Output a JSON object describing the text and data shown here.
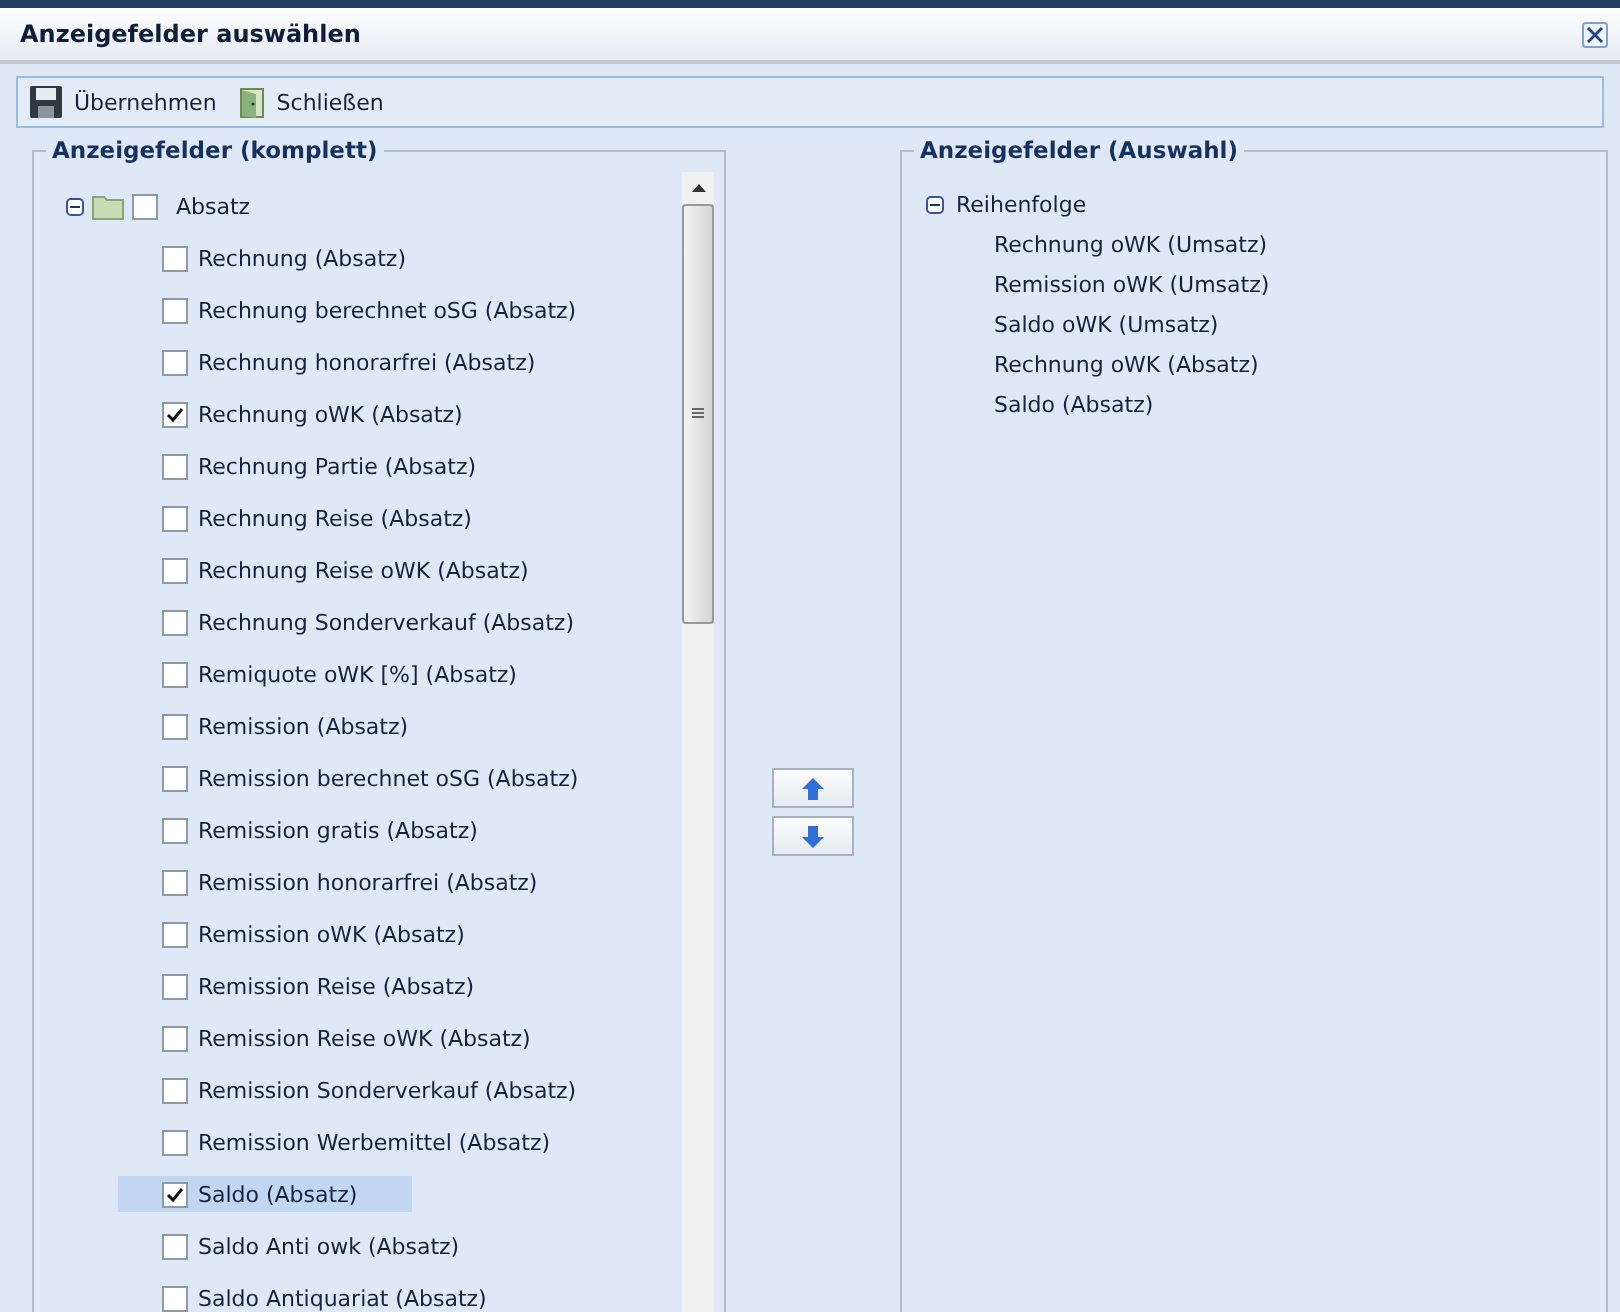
{
  "window": {
    "title": "Anzeigefelder auswählen"
  },
  "toolbar": [
    {
      "kind": "save",
      "label": "Übernehmen"
    },
    {
      "kind": "close",
      "label": "Schließen"
    }
  ],
  "left_panel": {
    "title": "Anzeigefelder (komplett)",
    "tree": [
      {
        "label": "Absatz",
        "expanded": true,
        "checked": false,
        "children": [
          {
            "label": "Rechnung (Absatz)",
            "checked": false,
            "selected": false
          },
          {
            "label": "Rechnung berechnet oSG (Absatz)",
            "checked": false,
            "selected": false
          },
          {
            "label": "Rechnung honorarfrei (Absatz)",
            "checked": false,
            "selected": false
          },
          {
            "label": "Rechnung oWK (Absatz)",
            "checked": true,
            "selected": false
          },
          {
            "label": "Rechnung Partie (Absatz)",
            "checked": false,
            "selected": false
          },
          {
            "label": "Rechnung Reise (Absatz)",
            "checked": false,
            "selected": false
          },
          {
            "label": "Rechnung Reise oWK (Absatz)",
            "checked": false,
            "selected": false
          },
          {
            "label": "Rechnung Sonderverkauf (Absatz)",
            "checked": false,
            "selected": false
          },
          {
            "label": "Remiquote oWK [%] (Absatz)",
            "checked": false,
            "selected": false
          },
          {
            "label": "Remission (Absatz)",
            "checked": false,
            "selected": false
          },
          {
            "label": "Remission berechnet oSG (Absatz)",
            "checked": false,
            "selected": false
          },
          {
            "label": "Remission gratis (Absatz)",
            "checked": false,
            "selected": false
          },
          {
            "label": "Remission honorarfrei (Absatz)",
            "checked": false,
            "selected": false
          },
          {
            "label": "Remission oWK (Absatz)",
            "checked": false,
            "selected": false
          },
          {
            "label": "Remission Reise (Absatz)",
            "checked": false,
            "selected": false
          },
          {
            "label": "Remission Reise oWK (Absatz)",
            "checked": false,
            "selected": false
          },
          {
            "label": "Remission Sonderverkauf (Absatz)",
            "checked": false,
            "selected": false
          },
          {
            "label": "Remission Werbemittel (Absatz)",
            "checked": false,
            "selected": false
          },
          {
            "label": "Saldo (Absatz)",
            "checked": true,
            "selected": true
          },
          {
            "label": "Saldo Anti owk (Absatz)",
            "checked": false,
            "selected": false
          },
          {
            "label": "Saldo Antiquariat (Absatz)",
            "checked": false,
            "selected": false
          }
        ]
      }
    ]
  },
  "move_buttons": [
    {
      "kind": "up"
    },
    {
      "kind": "down"
    }
  ],
  "right_panel": {
    "title": "Anzeigefelder (Auswahl)",
    "tree": [
      {
        "label": "Reihenfolge",
        "expanded": true,
        "children": [
          {
            "label": "Rechnung oWK (Umsatz)"
          },
          {
            "label": "Remission oWK (Umsatz)"
          },
          {
            "label": "Saldo oWK (Umsatz)"
          },
          {
            "label": "Rechnung oWK (Absatz)"
          },
          {
            "label": "Saldo (Absatz)"
          }
        ]
      }
    ]
  }
}
